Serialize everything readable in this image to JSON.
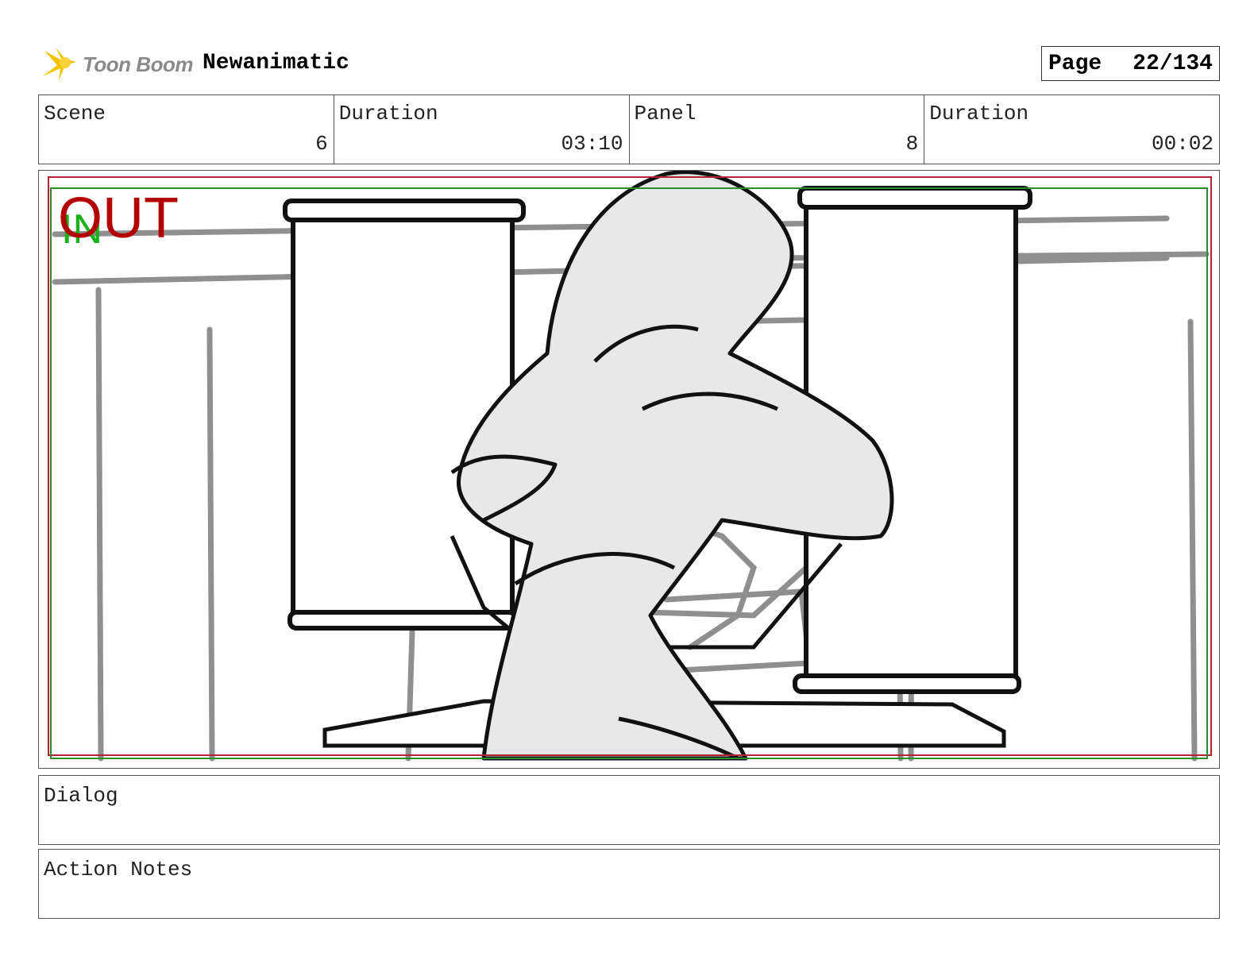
{
  "header": {
    "logo_text": "Toon Boom",
    "project_title": "Newanimatic",
    "page_label": "Page",
    "page_value": "22/134"
  },
  "info": [
    {
      "label": "Scene",
      "value": "6"
    },
    {
      "label": "Duration",
      "value": "03:10"
    },
    {
      "label": "Panel",
      "value": "8"
    },
    {
      "label": "Duration",
      "value": "00:02"
    }
  ],
  "panel": {
    "in_marker": "IN",
    "out_marker": "OUT"
  },
  "dialog": {
    "label": "Dialog"
  },
  "notes": {
    "label": "Action Notes"
  },
  "colors": {
    "frame_red": "#b22234",
    "frame_green": "#2e8b2e",
    "in_green": "#19b219",
    "out_red": "#b30000",
    "logo_yellow": "#f5c200"
  }
}
